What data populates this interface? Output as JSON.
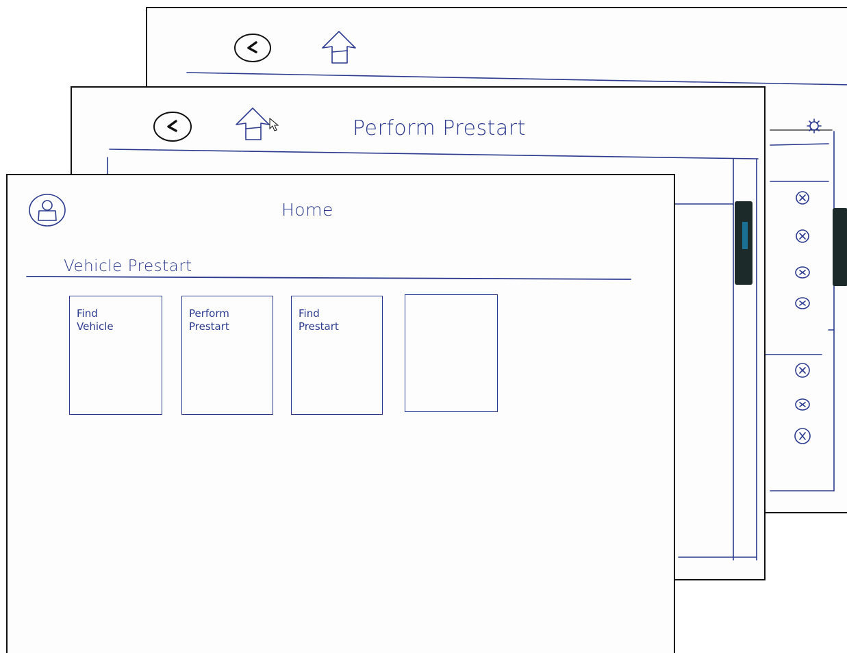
{
  "back_sheet": {
    "nav": {
      "back_icon": "chevron-left-icon",
      "home_icon": "home-icon"
    },
    "settings_icon": "gear-icon",
    "remove_icons": [
      "close-circle-icon",
      "close-circle-icon",
      "close-circle-icon",
      "close-circle-icon",
      "close-circle-icon",
      "close-circle-icon",
      "close-circle-icon"
    ]
  },
  "mid_sheet": {
    "title": "Perform Prestart",
    "nav": {
      "back_icon": "chevron-left-icon",
      "home_icon": "home-icon"
    }
  },
  "front_sheet": {
    "title": "Home",
    "profile_icon": "user-icon",
    "section_title": "Vehicle Prestart",
    "tiles": [
      {
        "label": "Find\nVehicle"
      },
      {
        "label": "Perform\nPrestart"
      },
      {
        "label": "Find\nPrestart"
      },
      {
        "label": ""
      }
    ]
  },
  "colors": {
    "ink": "#2b3a8f",
    "frame": "#111111",
    "scrollbar_thumb": "#1c2a2a"
  }
}
